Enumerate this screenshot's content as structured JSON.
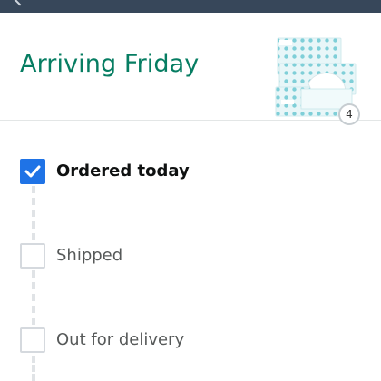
{
  "header": {
    "title": "Arriving Friday",
    "quantity": "4",
    "product_image": "tissue-box-product-image"
  },
  "tracker": {
    "steps": [
      {
        "label": "Ordered today",
        "checked": true
      },
      {
        "label": "Shipped",
        "checked": false
      },
      {
        "label": "Out for delivery",
        "checked": false
      }
    ]
  },
  "colors": {
    "accent_green": "#067d62",
    "checkbox_blue": "#1f73e6",
    "top_bar": "#37475a"
  },
  "icons": {
    "nav": "back-arrow-icon",
    "check": "checkmark-icon"
  }
}
